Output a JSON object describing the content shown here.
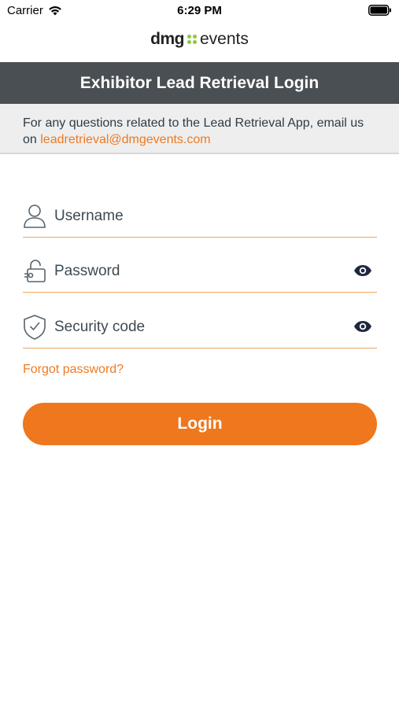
{
  "status_bar": {
    "carrier": "Carrier",
    "time": "6:29 PM"
  },
  "logo": {
    "part1": "dmg",
    "part2": "events",
    "dots_color": "#8dc63f"
  },
  "header": {
    "title": "Exhibitor Lead Retrieval Login",
    "background": "#4a4f53"
  },
  "info": {
    "text": "For any questions related to the Lead Retrieval App, email us on",
    "email": "leadretrieval@dmgevents.com"
  },
  "form": {
    "username": {
      "label": "Username",
      "icon": "user-icon"
    },
    "password": {
      "label": "Password",
      "icon": "lock-icon",
      "toggle_icon": "eye-icon"
    },
    "security_code": {
      "label": "Security code",
      "icon": "shield-check-icon",
      "toggle_icon": "eye-icon"
    },
    "forgot_password": "Forgot password?",
    "login_button": "Login"
  },
  "colors": {
    "accent": "#ef771d",
    "field_underline": "#f0a35c",
    "text": "#2f3b45"
  }
}
